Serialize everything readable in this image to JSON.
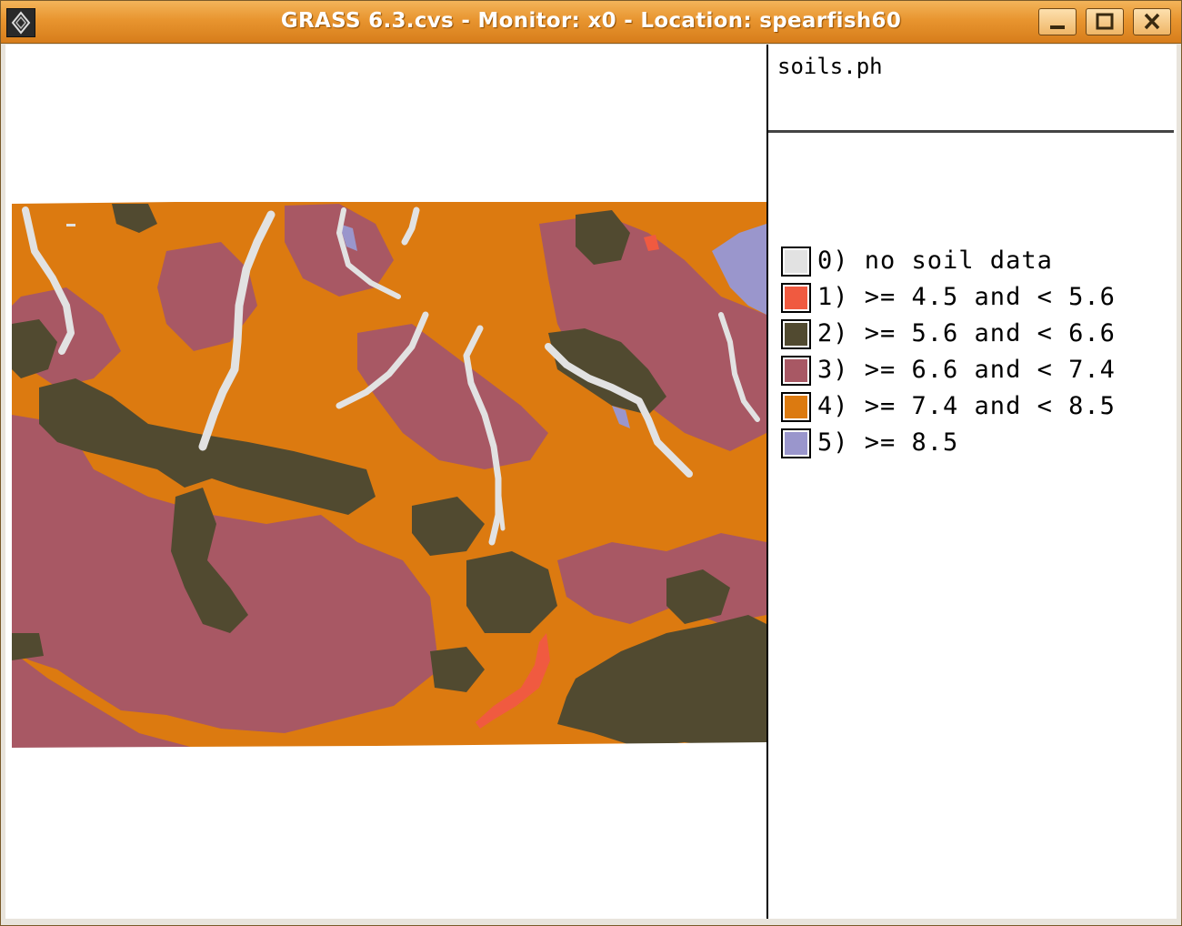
{
  "window": {
    "title": "GRASS 6.3.cvs - Monitor: x0 - Location: spearfish60",
    "icon": "grass-app-icon",
    "controls": {
      "minimize": "minimize-icon",
      "maximize": "maximize-icon",
      "close": "close-icon"
    }
  },
  "legend": {
    "title": "soils.ph",
    "items": [
      {
        "label": "0) no soil data",
        "color": "#e2e2e2"
      },
      {
        "label": "1) >= 4.5 and < 5.6",
        "color": "#f05a40"
      },
      {
        "label": "2) >= 5.6 and < 6.6",
        "color": "#514a30"
      },
      {
        "label": "3) >= 6.6 and < 7.4",
        "color": "#a85864"
      },
      {
        "label": "4) >= 7.4 and < 8.5",
        "color": "#dc7a10"
      },
      {
        "label": "5) >= 8.5",
        "color": "#9a96cc"
      }
    ]
  },
  "map": {
    "layer": "soils.ph",
    "colors": {
      "no_data": "#e2e2e2",
      "ph_4_5": "#f05a40",
      "ph_5_6": "#514a30",
      "ph_6_6": "#a85864",
      "ph_7_4": "#dc7a10",
      "ph_8_5": "#9a96cc"
    }
  }
}
